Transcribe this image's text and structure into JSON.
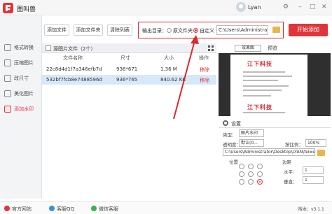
{
  "app": {
    "title": "图叫兽",
    "user": "Lyan",
    "version": "版本：v3.1.1"
  },
  "window_buttons": {
    "settings": "⚙",
    "minimize": "–",
    "maximize": "□",
    "close": "✕"
  },
  "sidebar": {
    "items": [
      {
        "label": "格式转换",
        "active": false
      },
      {
        "label": "压缩图片",
        "active": false
      },
      {
        "label": "改尺寸",
        "active": false
      },
      {
        "label": "美化图片",
        "active": false
      },
      {
        "label": "添加水印",
        "active": true
      }
    ]
  },
  "toolbar": {
    "add_file": "添加文件",
    "add_folder": "添加文件夹",
    "clear_list": "清除列表",
    "start": "开始添加"
  },
  "output": {
    "label": "输出目录：",
    "option_original": "原文件夹",
    "option_custom": "自定义",
    "selected": "自定义",
    "path": "C:\\Users\\Administrator\\"
  },
  "list": {
    "title": "源图片文件（2个）",
    "columns": {
      "name": "文件名称",
      "size": "尺寸",
      "filesize": "大小",
      "action": "操作"
    },
    "rows": [
      {
        "name": "22c8d4d1f7a346efb7d",
        "size": "936*671",
        "filesize": "1.36 M",
        "action": "移除",
        "selected": false
      },
      {
        "name": "532bf7fcb8e7488596d",
        "size": "936*765",
        "filesize": "840.62 KB",
        "action": "移除",
        "selected": true
      }
    ]
  },
  "preview": {
    "tab": "效果图",
    "label": "预览",
    "watermark_text": "江下科技"
  },
  "settings": {
    "title": "设置",
    "type_label": "类型：",
    "type_value": "图片水印",
    "opacity_label": "透明度：",
    "opacity_value": "默认(0...",
    "scale_label": "按比例：",
    "scale_value": "100%",
    "image_path": "C:\\Users\\Administrator\\Desktop\\LYAN\\feiwen\\",
    "position_label": "位置",
    "margin_label": "边距",
    "h_label": "水平：",
    "h_value": "1",
    "v_label": "垂直：",
    "v_value": "1"
  },
  "status": {
    "website": "官方网站",
    "qq": "客服QQ",
    "wechat": "微信客服"
  }
}
